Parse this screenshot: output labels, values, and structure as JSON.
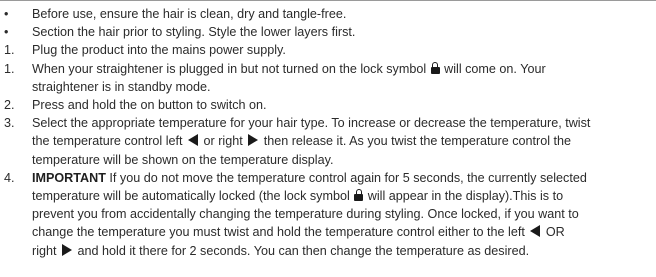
{
  "bullets": [
    {
      "marker": "•",
      "text": "Before use, ensure the hair is clean, dry and tangle-free."
    },
    {
      "marker": "•",
      "text": "Section the hair prior to styling. Style the lower layers first."
    }
  ],
  "prep_step": {
    "number": "1.",
    "text": "Plug the product into the mains power supply."
  },
  "steps": [
    {
      "number": "1.",
      "text_a": "When your straightener is plugged in but not turned on the lock symbol",
      "icon": "lock-icon",
      "text_b": "will come on. Your",
      "line2": "straightener is in standby mode."
    },
    {
      "number": "2.",
      "text": "Press and hold the on button to switch on."
    },
    {
      "number": "3.",
      "line1": "Select the appropriate temperature for your hair type. To increase or decrease the temperature, twist",
      "line2_a": "the temperature control left",
      "icon_left": "arrow-left-icon",
      "line2_b": "or right",
      "icon_right": "arrow-right-icon",
      "line2_c": "then release it. As you twist the temperature control the",
      "line3": "temperature will be shown on the temperature display."
    },
    {
      "number": "4.",
      "strong": "IMPORTANT",
      "line1": "If you do not move the temperature control again for 5 seconds, the currently selected",
      "line2_a": "temperature will be automatically locked (the lock symbol",
      "icon": "lock-icon",
      "line2_b": "will appear in the display).This is to",
      "line3": "prevent you from accidentally changing the temperature during styling. Once locked, if you want to",
      "line4_a": "change the temperature you must twist and hold the temperature control either to the left",
      "icon_left": "arrow-left-icon",
      "line4_b": "OR",
      "line5_a": "right",
      "icon_right": "arrow-right-icon",
      "line5_b": "and hold it there for 2 seconds. You can then change the temperature as desired."
    }
  ],
  "colors": {
    "text": "#2b2b2b",
    "icon": "#1a1a1a",
    "rule": "#9a9a9a"
  }
}
